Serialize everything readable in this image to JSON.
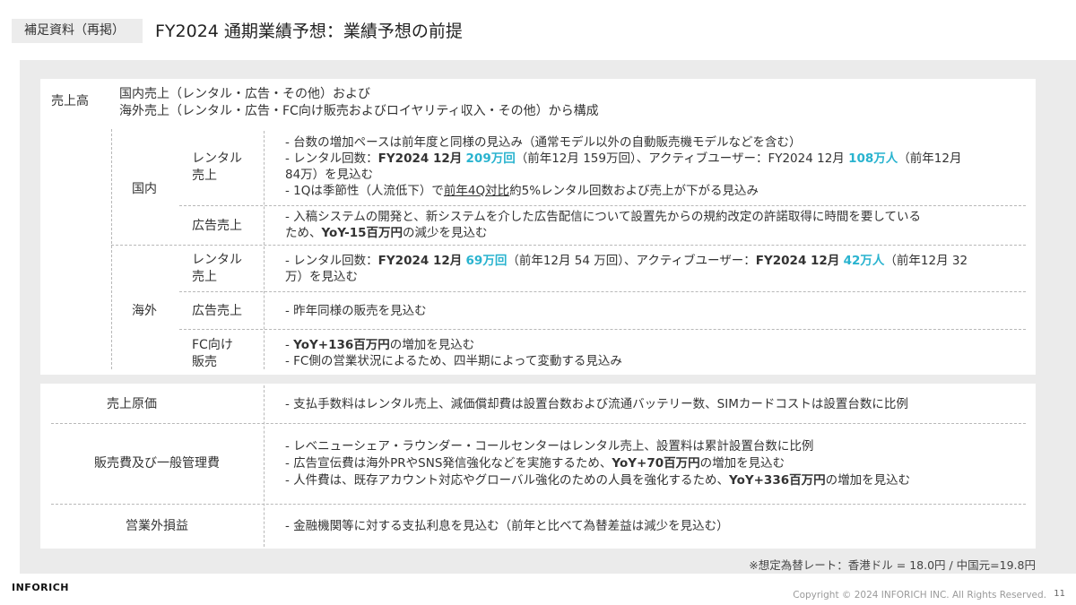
{
  "header": {
    "tag": "補足資料（再掲）",
    "title": "FY2024 通期業績予想：業績予想の前提"
  },
  "revenue": {
    "label": "売上高",
    "summary_line1": "国内売上（レンタル・広告・その他）および",
    "summary_line2": "海外売上（レンタル・広告・FC向け販売およびロイヤリティ収入・その他）から構成",
    "domestic": {
      "label": "国内",
      "rental": {
        "label_line1": "レンタル",
        "label_line2": "売上",
        "line1": "- 台数の増加ペースは前年度と同様の見込み（通常モデル以外の自動販売機モデルなどを含む）",
        "line2_a": "- レンタル回数：",
        "line2_b": "FY2024 12月",
        "line2_c": "209万回",
        "line2_d": "（前年12月 159万回）、アクティブユーザー：FY2024 12月",
        "line2_e": "108万人",
        "line2_f": "（前年12月",
        "line3": "84万）を見込む",
        "line4_a": "- 1Qは季節性（人流低下）で",
        "line4_b": "前年4Q対比",
        "line4_c": "約5%レンタル回数および売上が下がる見込み"
      },
      "ads": {
        "label": "広告売上",
        "line1": "- 入稿システムの開発と、新システムを介した広告配信について設置先からの規約改定の許諾取得に時間を要している",
        "line2_a": "ため、",
        "line2_b": "YoY-15百万円",
        "line2_c": "の減少を見込む"
      }
    },
    "overseas": {
      "label": "海外",
      "rental": {
        "label_line1": "レンタル",
        "label_line2": "売上",
        "line1_a": "- レンタル回数：",
        "line1_b": "FY2024 12月",
        "line1_c": "69万回",
        "line1_d": "（前年12月 54 万回）、アクティブユーザー：",
        "line1_e": "FY2024 12月",
        "line1_f": "42万人",
        "line1_g": "（前年12月 32",
        "line2": "万）を見込む"
      },
      "ads": {
        "label": "広告売上",
        "line1": "-  昨年同様の販売を見込む"
      },
      "fc": {
        "label_line1": "FC向け",
        "label_line2": "販売",
        "line1_a": "- ",
        "line1_b": "YoY+136百万円",
        "line1_c": "の増加を見込む",
        "line2": "- FC側の営業状況によるため、四半期によって変動する見込み"
      }
    }
  },
  "cost": {
    "cogs": {
      "label": "売上原価",
      "line1": "- 支払手数料はレンタル売上、減価償却費は設置台数および流通バッテリー数、SIMカードコストは設置台数に比例"
    },
    "sga": {
      "label": "販売費及び一般管理費",
      "line1": "- レベニューシェア・ラウンダー・コールセンターはレンタル売上、設置料は累計設置台数に比例",
      "line2_a": "- 広告宣伝費は海外PRやSNS発信強化などを実施するため、",
      "line2_b": "YoY+70百万円",
      "line2_c": "の増加を見込む",
      "line3_a": "- 人件費は、既存アカウント対応やグローバル強化のための人員を強化するため、",
      "line3_b": "YoY+336百万円",
      "line3_c": "の増加を見込む"
    },
    "nonop": {
      "label": "営業外損益",
      "line1": "- 金融機関等に対する支払利息を見込む（前年と比べて為替差益は減少を見込む）"
    }
  },
  "footer": {
    "note": "※想定為替レート：香港ドル = 18.0円 / 中国元=19.8円",
    "brand": "INFORICH",
    "copyright": "Copyright © 2024 INFORICH INC. All Rights Reserved.",
    "page": "11"
  },
  "colors": {
    "highlight": "#29b3cf",
    "panel_bg": "#ebebeb",
    "tag_bg": "#ececec"
  }
}
